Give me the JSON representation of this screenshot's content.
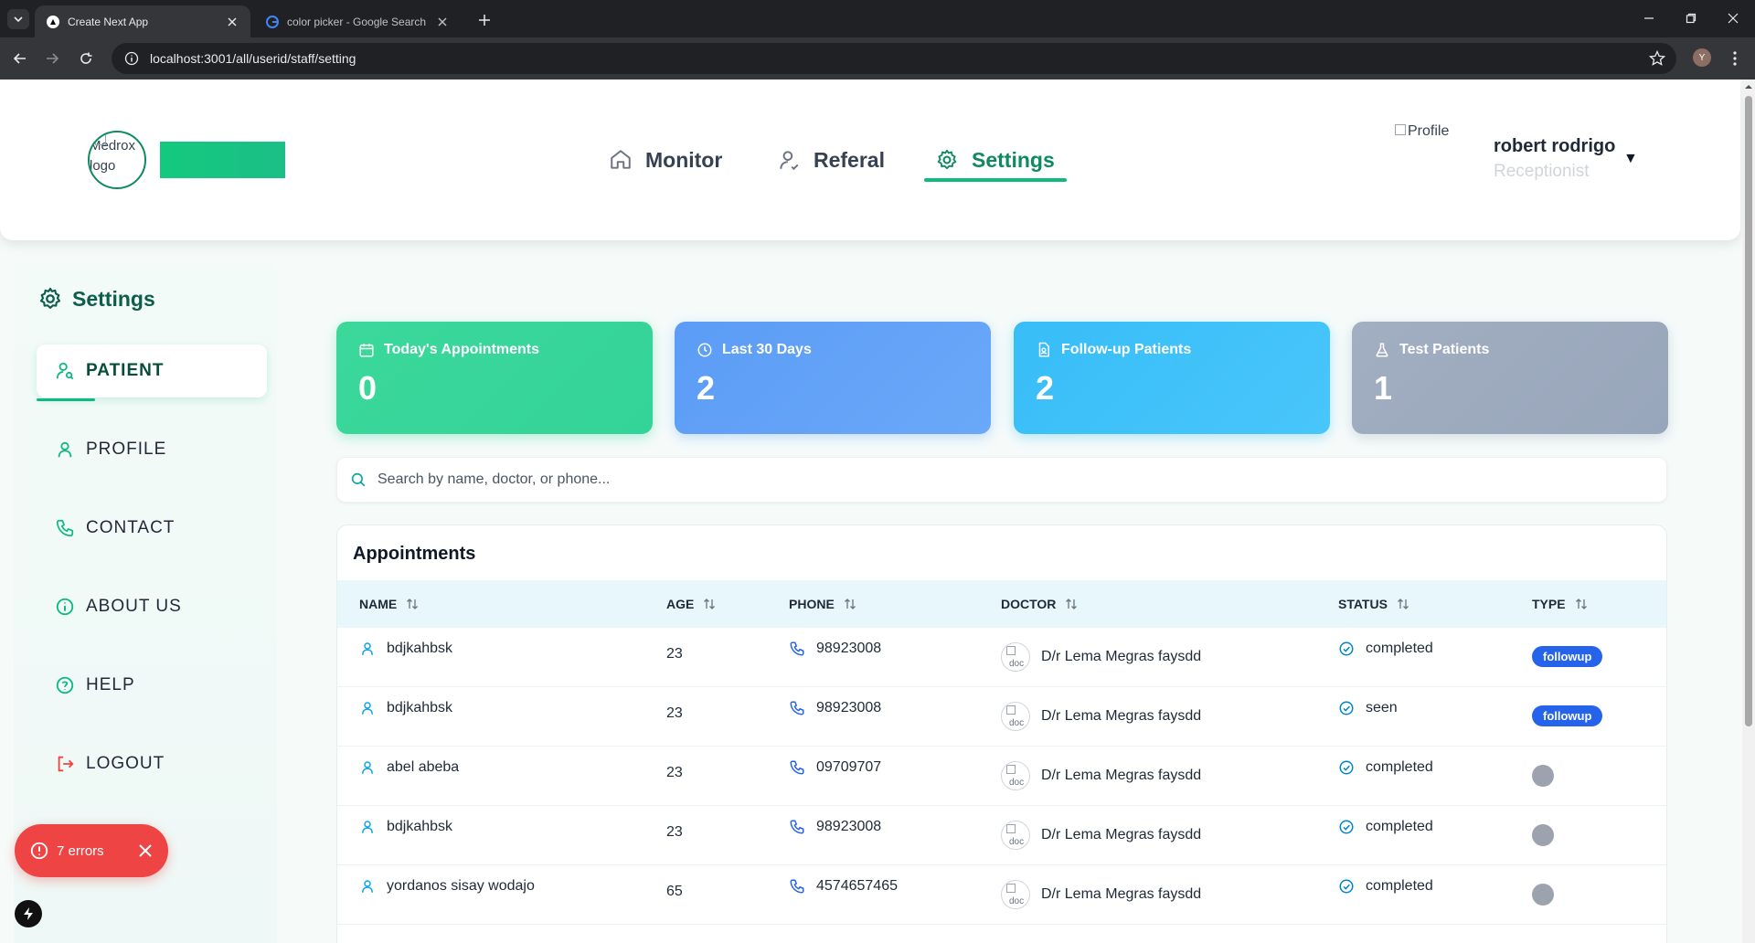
{
  "browser": {
    "tabs": [
      {
        "title": "Create Next App",
        "active": true
      },
      {
        "title": "color picker - Google Search",
        "active": false
      }
    ],
    "url": "localhost:3001/all/userid/staff/setting",
    "profile_initial": "Y"
  },
  "header": {
    "logo_alt": "Medrox logo",
    "nav": [
      {
        "label": "Monitor",
        "icon": "home-icon"
      },
      {
        "label": "Referal",
        "icon": "user-icon"
      },
      {
        "label": "Settings",
        "icon": "gear-icon",
        "active": true
      }
    ],
    "profile_alt": "Profile",
    "user_name": "robert rodrigo",
    "user_role": "Receptionist",
    "caret": "▼"
  },
  "sidebar": {
    "title": "Settings",
    "items": [
      {
        "label": "PATIENT",
        "icon": "user-search-icon",
        "active": true
      },
      {
        "label": "PROFILE",
        "icon": "user-icon"
      },
      {
        "label": "CONTACT",
        "icon": "phone-icon"
      },
      {
        "label": "ABOUT US",
        "icon": "info-icon"
      },
      {
        "label": "HELP",
        "icon": "help-icon"
      },
      {
        "label": "LOGOUT",
        "icon": "logout-icon"
      }
    ]
  },
  "dev_overlay": {
    "errors": "7 errors"
  },
  "stats": [
    {
      "label": "Today's Appointments",
      "value": "0",
      "icon": "calendar-icon",
      "color": "#34d399"
    },
    {
      "label": "Last 30 Days",
      "value": "2",
      "icon": "clock-icon",
      "color": "#60a5fa"
    },
    {
      "label": "Follow-up Patients",
      "value": "2",
      "icon": "file-user-icon",
      "color": "#38bdf8"
    },
    {
      "label": "Test Patients",
      "value": "1",
      "icon": "flask-icon",
      "color": "#94a3b8"
    }
  ],
  "search": {
    "placeholder": "Search by name, doctor, or phone..."
  },
  "appointments": {
    "title": "Appointments",
    "columns": [
      "NAME",
      "AGE",
      "PHONE",
      "DOCTOR",
      "STATUS",
      "TYPE"
    ],
    "doctor_avatar_alt": "doc",
    "rows": [
      {
        "name": "bdjkahbsk",
        "age": "23",
        "phone": "98923008",
        "doctor": "D/r Lema Megras faysdd",
        "status": "completed",
        "type": "followup"
      },
      {
        "name": "bdjkahbsk",
        "age": "23",
        "phone": "98923008",
        "doctor": "D/r Lema Megras faysdd",
        "status": "seen",
        "type": "followup"
      },
      {
        "name": "abel abeba",
        "age": "23",
        "phone": "09709707",
        "doctor": "D/r Lema Megras faysdd",
        "status": "completed",
        "type": ""
      },
      {
        "name": "bdjkahbsk",
        "age": "23",
        "phone": "98923008",
        "doctor": "D/r Lema Megras faysdd",
        "status": "completed",
        "type": ""
      },
      {
        "name": "yordanos sisay wodajo",
        "age": "65",
        "phone": "4574657465",
        "doctor": "D/r Lema Megras faysdd",
        "status": "completed",
        "type": ""
      }
    ]
  },
  "colors": {
    "brand": "#0f8a5f",
    "accent": "#10b981",
    "badge": "#2563eb",
    "error": "#ef4444"
  }
}
